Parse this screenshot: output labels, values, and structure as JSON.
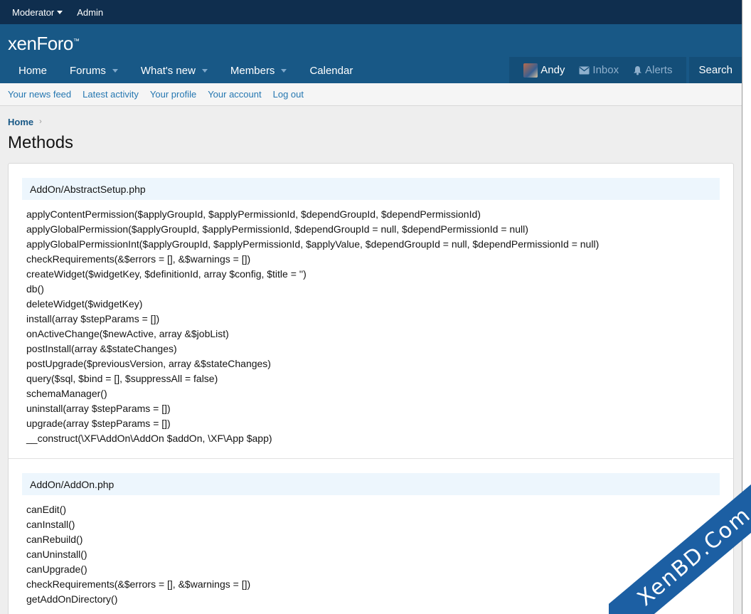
{
  "staff_bar": {
    "moderator": "Moderator",
    "admin": "Admin"
  },
  "header": {
    "logo": "xenForo",
    "logo_mark": "™"
  },
  "nav": {
    "tabs": [
      {
        "label": "Home",
        "dropdown": false
      },
      {
        "label": "Forums",
        "dropdown": true
      },
      {
        "label": "What's new",
        "dropdown": true
      },
      {
        "label": "Members",
        "dropdown": true
      },
      {
        "label": "Calendar",
        "dropdown": false
      }
    ],
    "user": {
      "name": "Andy",
      "inbox": "Inbox",
      "alerts": "Alerts"
    },
    "search": "Search"
  },
  "subnav": {
    "links": [
      "Your news feed",
      "Latest activity",
      "Your profile",
      "Your account",
      "Log out"
    ]
  },
  "breadcrumb": {
    "home": "Home",
    "separator": "›"
  },
  "page_title": "Methods",
  "sections": [
    {
      "file": "AddOn/AbstractSetup.php",
      "methods": [
        "applyContentPermission($applyGroupId, $applyPermissionId, $dependGroupId, $dependPermissionId)",
        "applyGlobalPermission($applyGroupId, $applyPermissionId, $dependGroupId = null, $dependPermissionId = null)",
        "applyGlobalPermissionInt($applyGroupId, $applyPermissionId, $applyValue, $dependGroupId = null, $dependPermissionId = null)",
        "checkRequirements(&$errors = [], &$warnings = [])",
        "createWidget($widgetKey, $definitionId, array $config, $title = '')",
        "db()",
        "deleteWidget($widgetKey)",
        "install(array $stepParams = [])",
        "onActiveChange($newActive, array &$jobList)",
        "postInstall(array &$stateChanges)",
        "postUpgrade($previousVersion, array &$stateChanges)",
        "query($sql, $bind = [], $suppressAll = false)",
        "schemaManager()",
        "uninstall(array $stepParams = [])",
        "upgrade(array $stepParams = [])",
        "__construct(\\XF\\AddOn\\AddOn $addOn, \\XF\\App $app)"
      ]
    },
    {
      "file": "AddOn/AddOn.php",
      "methods": [
        "canEdit()",
        "canInstall()",
        "canRebuild()",
        "canUninstall()",
        "canUpgrade()",
        "checkRequirements(&$errors = [], &$warnings = [])",
        "getAddOnDirectory()"
      ]
    }
  ],
  "watermark": "XenBD.Com",
  "colors": {
    "staff_bar": "#0f2e4e",
    "header": "#185886",
    "link": "#2577b1",
    "file_header_bg": "#edf6fd",
    "watermark": "#1c5fa3"
  }
}
